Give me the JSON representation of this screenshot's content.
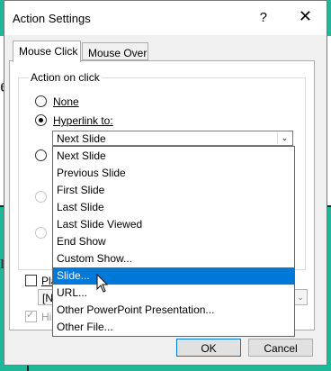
{
  "dialog": {
    "title": "Action Settings",
    "help": "?",
    "close": "✕"
  },
  "tabs": [
    {
      "label": "Mouse Click",
      "active": true
    },
    {
      "label": "Mouse Over",
      "active": false
    }
  ],
  "group": {
    "legend": "Action on click"
  },
  "options": {
    "none_label": "None",
    "hyperlink_label": "Hyperlink to:"
  },
  "hyperlink_select": {
    "value": "Next Slide",
    "arrow": "⌄"
  },
  "dropdown": {
    "items": [
      "Next Slide",
      "Previous Slide",
      "First Slide",
      "Last Slide",
      "Last Slide Viewed",
      "End Show",
      "Custom Show...",
      "Slide...",
      "URL...",
      "Other PowerPoint Presentation...",
      "Other File..."
    ],
    "highlighted": "Slide..."
  },
  "partial": {
    "play_sound": "Pla",
    "sound_combo": "[N",
    "highlight": "Hi"
  },
  "buttons": {
    "ok": "OK",
    "cancel": "Cancel"
  },
  "background": {
    "glyph_right": "e",
    "glyph_left": "e",
    "glyph_left2": "r"
  },
  "colors": {
    "slide_bg": "#1fb79a",
    "selection": "#0078d7"
  }
}
